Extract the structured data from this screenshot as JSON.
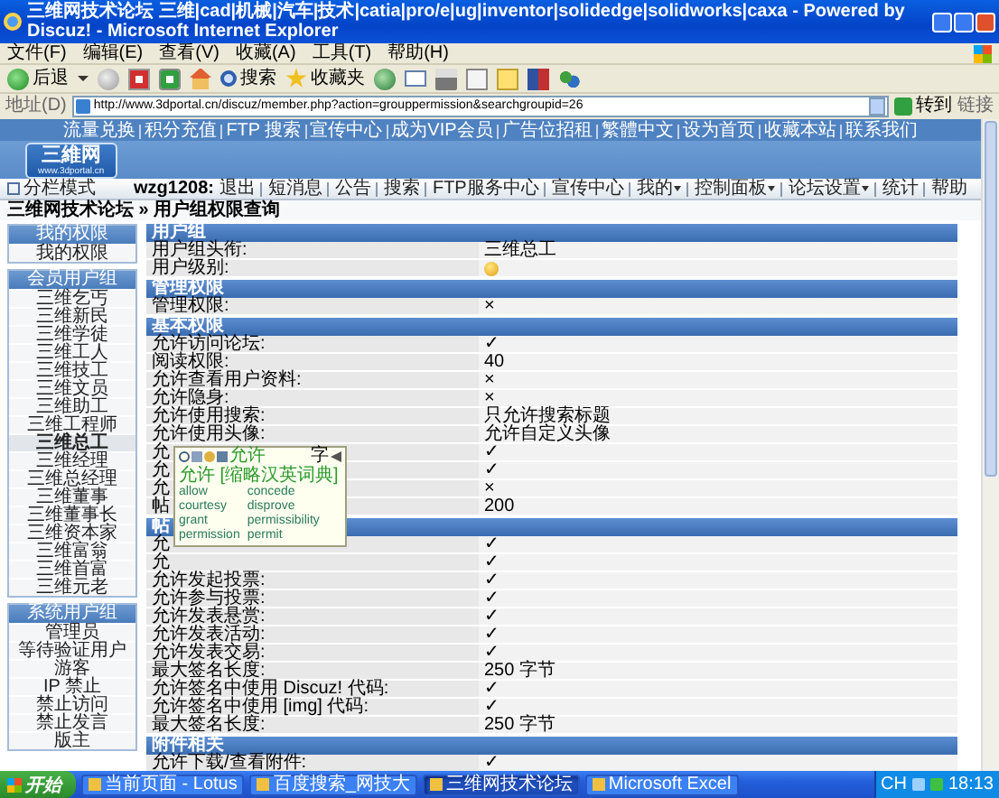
{
  "window": {
    "title": "三维网技术论坛 三维|cad|机械|汽车|技术|catia|pro/e|ug|inventor|solidedge|solidworks|caxa - Powered by Discuz! - Microsoft Internet Explorer"
  },
  "menu": [
    "文件(F)",
    "编辑(E)",
    "查看(V)",
    "收藏(A)",
    "工具(T)",
    "帮助(H)"
  ],
  "toolbar": {
    "back": "后退",
    "search": "搜索",
    "favorites": "收藏夹"
  },
  "address": {
    "label": "地址(D)",
    "url": "http://www.3dportal.cn/discuz/member.php?action=grouppermission&searchgroupid=26",
    "go": "转到",
    "links": "链接"
  },
  "site": {
    "top_links": [
      "流量兑换",
      "积分充值",
      "FTP 搜索",
      "宣传中心",
      "成为VIP会员",
      "广告位招租",
      "繁體中文",
      "设为首页",
      "收藏本站",
      "联系我们"
    ],
    "logo": {
      "name": "三維网",
      "url": "www.3dportal.cn"
    },
    "layout_toggle": "分栏模式",
    "user": "wzg1208:",
    "user_links": [
      {
        "label": "退出",
        "dropdown": false
      },
      {
        "label": "短消息",
        "dropdown": false
      },
      {
        "label": "公告",
        "dropdown": false
      },
      {
        "label": "搜索",
        "dropdown": false
      },
      {
        "label": "FTP服务中心",
        "dropdown": false
      },
      {
        "label": "宣传中心",
        "dropdown": false
      },
      {
        "label": "我的",
        "dropdown": true
      },
      {
        "label": "控制面板",
        "dropdown": true
      },
      {
        "label": "论坛设置",
        "dropdown": true
      },
      {
        "label": "统计",
        "dropdown": false
      },
      {
        "label": "帮助",
        "dropdown": false
      }
    ],
    "breadcrumb": "三维网技术论坛 » 用户组权限查询"
  },
  "sidebar": {
    "groups": [
      {
        "title": "我的权限",
        "items": [
          {
            "label": "我的权限",
            "selected": false
          }
        ]
      },
      {
        "title": "会员用户组",
        "items": [
          {
            "label": "三维乞丐",
            "selected": false
          },
          {
            "label": "三维新民",
            "selected": false
          },
          {
            "label": "三维学徒",
            "selected": false
          },
          {
            "label": "三维工人",
            "selected": false
          },
          {
            "label": "三维技工",
            "selected": false
          },
          {
            "label": "三维文员",
            "selected": false
          },
          {
            "label": "三维助工",
            "selected": false
          },
          {
            "label": "三维工程师",
            "selected": false
          },
          {
            "label": "三维总工",
            "selected": true
          },
          {
            "label": "三维经理",
            "selected": false
          },
          {
            "label": "三维总经理",
            "selected": false
          },
          {
            "label": "三维董事",
            "selected": false
          },
          {
            "label": "三维董事长",
            "selected": false
          },
          {
            "label": "三维资本家",
            "selected": false
          },
          {
            "label": "三维富翁",
            "selected": false
          },
          {
            "label": "三维首富",
            "selected": false
          },
          {
            "label": "三维元老",
            "selected": false
          }
        ]
      },
      {
        "title": "系统用户组",
        "items": [
          {
            "label": "管理员",
            "selected": false
          },
          {
            "label": "等待验证用户",
            "selected": false
          },
          {
            "label": "游客",
            "selected": false
          },
          {
            "label": "IP 禁止",
            "selected": false
          },
          {
            "label": "禁止访问",
            "selected": false
          },
          {
            "label": "禁止发言",
            "selected": false
          },
          {
            "label": "版主",
            "selected": false
          }
        ]
      }
    ]
  },
  "permissions": {
    "sections": [
      {
        "title": "用户组",
        "rows": [
          {
            "kind": "text",
            "label": "用户组头衔:",
            "value": "三维总工"
          },
          {
            "kind": "level-icon",
            "label": "用户级别:"
          }
        ]
      },
      {
        "title": "管理权限",
        "rows": [
          {
            "kind": "text",
            "label": "管理权限:",
            "value": "×"
          }
        ]
      },
      {
        "title": "基本权限",
        "rows": [
          {
            "kind": "text",
            "label": "允许访问论坛:",
            "value": "✓"
          },
          {
            "kind": "text",
            "label": "阅读权限:",
            "value": "40"
          },
          {
            "kind": "text",
            "label": "允许查看用户资料:",
            "value": "×"
          },
          {
            "kind": "text",
            "label": "允许隐身:",
            "value": "×"
          },
          {
            "kind": "text",
            "label": "允许使用搜索:",
            "value": "只允许搜索标题"
          },
          {
            "kind": "text",
            "label": "允许使用头像:",
            "value": "允许自定义头像"
          },
          {
            "kind": "text",
            "label": "允",
            "value": "✓"
          },
          {
            "kind": "text",
            "label": "允",
            "value": "✓"
          },
          {
            "kind": "text",
            "label": "允",
            "value": "×"
          },
          {
            "kind": "text",
            "label": "帖",
            "value": "200"
          }
        ]
      },
      {
        "title": "帖",
        "rows": [
          {
            "kind": "text",
            "label": "允",
            "value": "✓"
          },
          {
            "kind": "text",
            "label": "允",
            "value": "✓"
          },
          {
            "kind": "text",
            "label": "允许发起投票:",
            "value": "✓"
          },
          {
            "kind": "text",
            "label": "允许参与投票:",
            "value": "✓"
          },
          {
            "kind": "text",
            "label": "允许发表悬赏:",
            "value": "✓"
          },
          {
            "kind": "text",
            "label": "允许发表活动:",
            "value": "✓"
          },
          {
            "kind": "text",
            "label": "允许发表交易:",
            "value": "✓"
          },
          {
            "kind": "text",
            "label": "最大签名长度:",
            "value": "250 字节"
          },
          {
            "kind": "text",
            "label": "允许签名中使用 Discuz! 代码:",
            "value": "✓"
          },
          {
            "kind": "text",
            "label": "允许签名中使用 [img] 代码:",
            "value": "✓"
          },
          {
            "kind": "text",
            "label": "最大签名长度:",
            "value": "250 字节"
          }
        ]
      },
      {
        "title": "附件相关",
        "rows": [
          {
            "kind": "text",
            "label": "允许下载/查看附件:",
            "value": "✓"
          }
        ]
      }
    ]
  },
  "dictionary_popup": {
    "word": "允许",
    "mode": "字",
    "source": "允许 [缩略汉英词典]",
    "entries": [
      "allow",
      "concede",
      "courtesy",
      "disprove",
      "grant",
      "permissibility",
      "permission",
      "permit"
    ]
  },
  "taskbar": {
    "start": "开始",
    "tasks": [
      {
        "label": "当前页面 - Lotus",
        "selected": false
      },
      {
        "label": "百度搜索_网技大",
        "selected": false
      },
      {
        "label": "三维网技术论坛",
        "selected": true
      },
      {
        "label": "Microsoft Excel",
        "selected": false
      }
    ],
    "tray": "CH",
    "clock": "18:13"
  }
}
